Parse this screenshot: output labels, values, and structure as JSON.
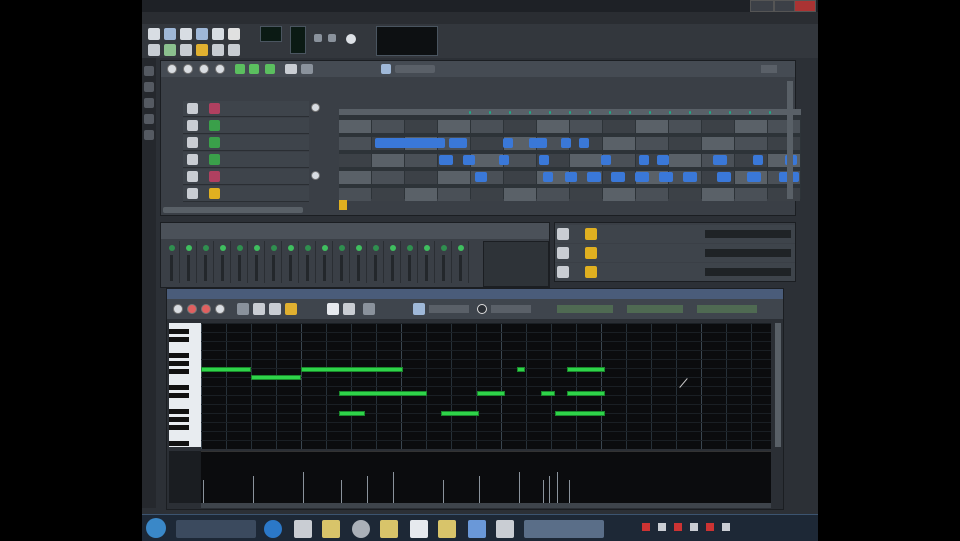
{
  "window": {
    "title": ""
  },
  "menubar": {
    "items": [
      "",
      "",
      "",
      "",
      ""
    ]
  },
  "toolbar": {
    "lcd_label": "",
    "lcd_value": ""
  },
  "song_editor": {
    "title": "",
    "tracks": [
      {
        "name": "",
        "icon_color": "#b04060"
      },
      {
        "name": "",
        "icon_color": "#3aa04a"
      },
      {
        "name": "",
        "icon_color": "#3aa04a"
      },
      {
        "name": "",
        "icon_color": "#3aa04a"
      },
      {
        "name": "",
        "icon_color": "#b04060"
      },
      {
        "name": "",
        "icon_color": "#e0b020"
      }
    ]
  },
  "fx_mixer": {
    "channel_count": 18
  },
  "instruments": {
    "rows": [
      {
        "name": ""
      },
      {
        "name": ""
      },
      {
        "name": ""
      }
    ]
  },
  "piano_roll": {
    "title": "",
    "velocity_label": "",
    "note_color": "#2fd44a"
  },
  "taskbar": {
    "start_label": "",
    "active_task": ""
  },
  "colors": {
    "accent": "#3a78d8",
    "window_bg": "#2c3036",
    "roll_bg": "#0b0c0e"
  }
}
